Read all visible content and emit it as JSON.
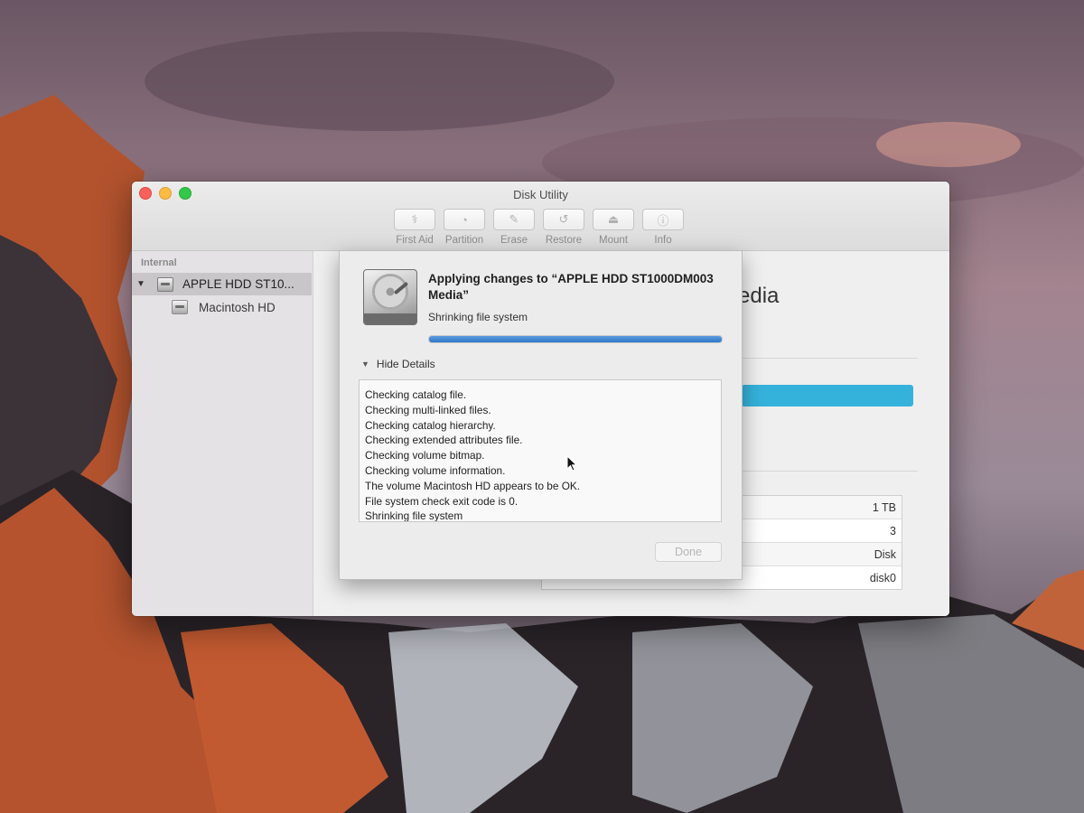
{
  "window": {
    "title": "Disk Utility",
    "toolbar": [
      {
        "label": "First Aid",
        "icon": "first-aid-icon",
        "glyph": "⚕"
      },
      {
        "label": "Partition",
        "icon": "partition-icon",
        "glyph": "◔"
      },
      {
        "label": "Erase",
        "icon": "erase-icon",
        "glyph": "✎"
      },
      {
        "label": "Restore",
        "icon": "restore-icon",
        "glyph": "↺"
      },
      {
        "label": "Mount",
        "icon": "mount-icon",
        "glyph": "⏏"
      },
      {
        "label": "Info",
        "icon": "info-icon",
        "glyph": "ⓘ"
      }
    ]
  },
  "sidebar": {
    "section": "Internal",
    "disk": "APPLE HDD ST10...",
    "volume": "Macintosh HD"
  },
  "main": {
    "title_visible": "edia",
    "info_values": [
      "1 TB",
      "3",
      "Disk",
      "disk0"
    ],
    "usage_color": "#35b2db"
  },
  "sheet": {
    "title": "Applying changes to “APPLE HDD ST1000DM003 Media”",
    "status": "Shrinking file system",
    "progress": 1.0,
    "details_toggle": "Hide Details",
    "log": [
      "Checking catalog file.",
      "Checking multi-linked files.",
      "Checking catalog hierarchy.",
      "Checking extended attributes file.",
      "Checking volume bitmap.",
      "Checking volume information.",
      "The volume Macintosh HD appears to be OK.",
      "File system check exit code is 0.",
      "Shrinking file system"
    ],
    "done_label": "Done"
  }
}
